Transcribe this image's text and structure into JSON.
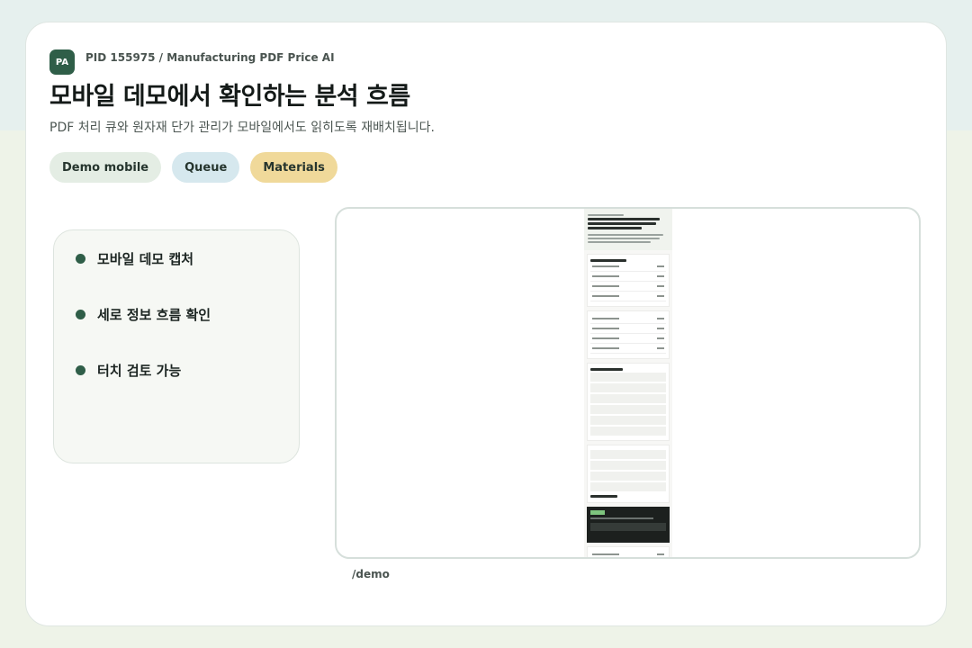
{
  "header": {
    "badge": "PA",
    "pid": "PID 155975 / Manufacturing PDF Price AI",
    "title": "모바일 데모에서 확인하는 분석 흐름",
    "subtitle": "PDF 처리 큐와 원자재 단가 관리가 모바일에서도 읽히도록 재배치됩니다."
  },
  "chips": [
    "Demo mobile",
    "Queue",
    "Materials"
  ],
  "side_items": [
    "모바일 데모 캡처",
    "세로 정보 흐름 확인",
    "터치 검토 가능"
  ],
  "preview": {
    "path": "/demo"
  },
  "colors": {
    "accent": "#2f5e48",
    "chip_demo": "#e4ede4",
    "chip_queue": "#d6e8ee",
    "chip_materials": "#f0d99a"
  }
}
